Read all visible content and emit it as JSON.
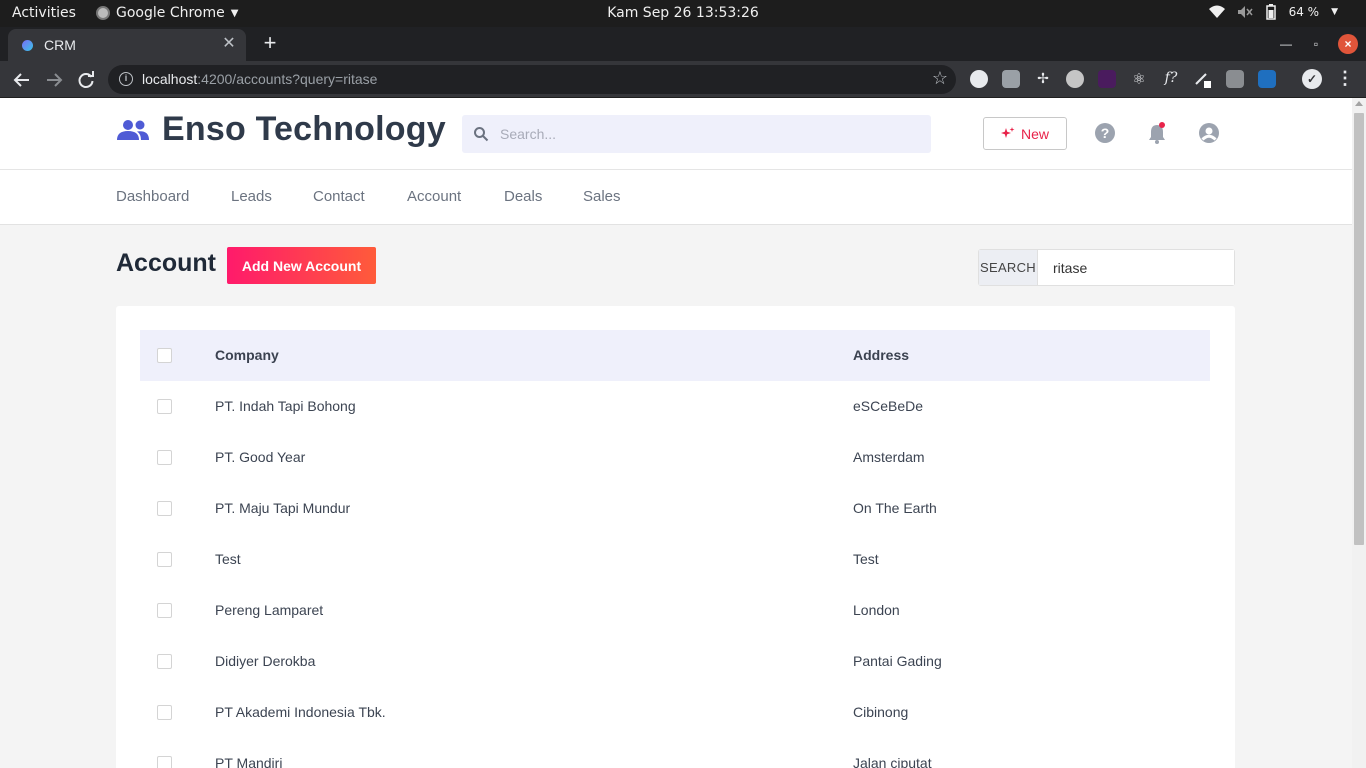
{
  "os": {
    "activities": "Activities",
    "app_name": "Google Chrome",
    "clock": "Kam Sep 26  13:53:26",
    "battery": "64 %"
  },
  "browser": {
    "tab_title": "CRM",
    "url_host": "localhost",
    "url_rest": ":4200/accounts?query=ritase"
  },
  "header": {
    "brand": "Enso Technology",
    "search_placeholder": "Search...",
    "new_label": "New"
  },
  "nav": [
    "Dashboard",
    "Leads",
    "Contact",
    "Account",
    "Deals",
    "Sales"
  ],
  "page": {
    "title": "Account",
    "add_button": "Add New Account",
    "search_label": "SEARCH",
    "search_value": "ritase"
  },
  "table": {
    "headers": {
      "company": "Company",
      "address": "Address"
    },
    "rows": [
      {
        "company": "PT. Indah Tapi Bohong",
        "address": "eSCeBeDe"
      },
      {
        "company": "PT. Good Year",
        "address": "Amsterdam"
      },
      {
        "company": "PT. Maju Tapi Mundur",
        "address": "On The Earth"
      },
      {
        "company": "Test",
        "address": "Test"
      },
      {
        "company": "Pereng Lamparet",
        "address": "London"
      },
      {
        "company": "Didiyer Derokba",
        "address": "Pantai Gading"
      },
      {
        "company": "PT Akademi Indonesia Tbk.",
        "address": "Cibinong"
      },
      {
        "company": "PT Mandiri",
        "address": "Jalan ciputat"
      }
    ]
  },
  "colors": {
    "brand_icon": "#4f5bd5",
    "accent_pink": "#ff1a6b",
    "notification_dot": "#e8234a"
  }
}
